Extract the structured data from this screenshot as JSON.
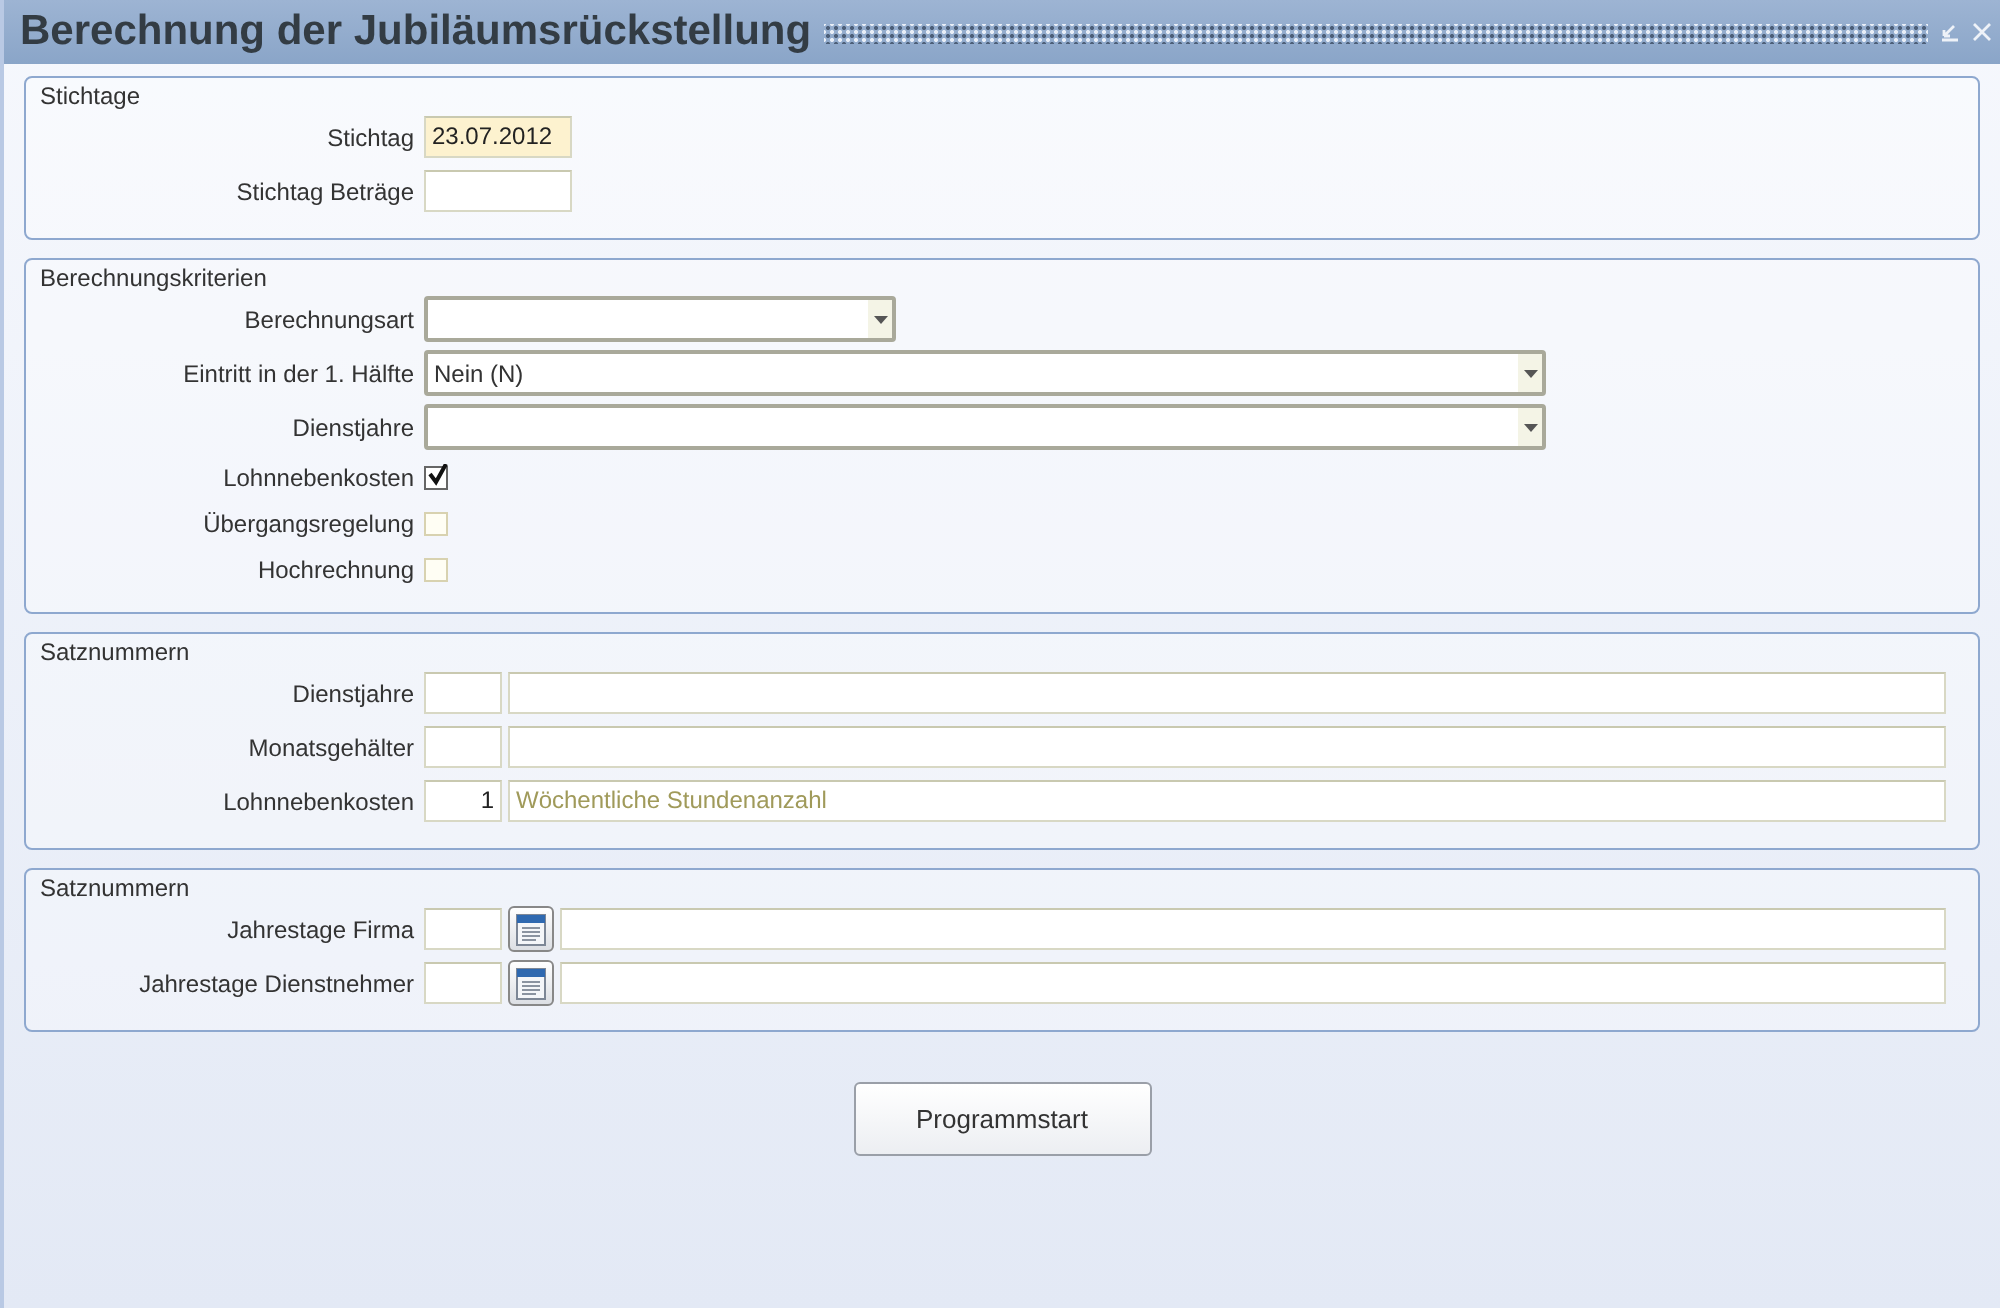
{
  "window": {
    "title": "Berechnung der Jubiläumsrückstellung"
  },
  "sections": [
    {
      "legend": "Stichtage",
      "rows": [
        {
          "kind": "field",
          "label": "Stichtag",
          "value": "23.07.2012",
          "highlighted": true
        },
        {
          "kind": "field",
          "label": "Stichtag Beträge",
          "highlighted": false
        }
      ]
    },
    {
      "legend": "Berechnungskriterien",
      "rows": [
        {
          "kind": "dropdown",
          "label": "Berechnungsart"
        },
        {
          "kind": "dropdown",
          "label": "Eintritt in der 1. Hälfte",
          "value": "Nein (N)"
        },
        {
          "kind": "dropdown",
          "label": "Dienstjahre"
        },
        {
          "kind": "checkbox",
          "label": "Lohnnebenkosten",
          "checked": true
        },
        {
          "kind": "checkbox",
          "label": "Übergangsregelung",
          "checked": false
        },
        {
          "kind": "checkbox",
          "label": "Hochrechnung",
          "checked": false
        }
      ]
    },
    {
      "legend": "Satznummern",
      "rows": [
        {
          "kind": "pair",
          "label": "Dienstjahre"
        },
        {
          "kind": "pair",
          "label": "Monatsgehälter"
        },
        {
          "kind": "pair",
          "label": "Lohnnebenkosten",
          "number": "1",
          "description": "Wöchentliche Stundenanzahl"
        }
      ]
    },
    {
      "legend": "Satznummern",
      "rows": [
        {
          "kind": "lookup",
          "label": "Jahrestage Firma"
        },
        {
          "kind": "lookup",
          "label": "Jahrestage Dienstnehmer"
        }
      ]
    }
  ],
  "buttons": [
    {
      "label": "Programmstart"
    }
  ]
}
